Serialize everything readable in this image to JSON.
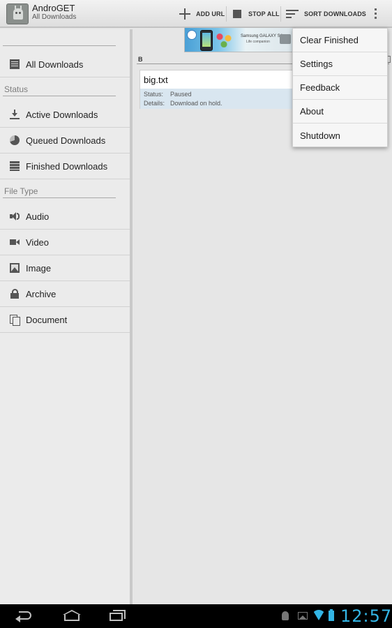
{
  "actionbar": {
    "title": "AndroGET",
    "subtitle": "All Downloads",
    "actions": {
      "add_url": "ADD URL",
      "stop_all": "STOP ALL",
      "sort_downloads": "SORT DOWNLOADS"
    }
  },
  "sidebar": {
    "all_downloads": "All Downloads",
    "status_section": "Status",
    "status_items": [
      "Active Downloads",
      "Queued Downloads",
      "Finished Downloads"
    ],
    "filetype_section": "File Type",
    "filetype_items": [
      "Audio",
      "Video",
      "Image",
      "Archive",
      "Document"
    ]
  },
  "main": {
    "ad": {
      "text": "Samsung GALAXY S4",
      "tagline": "Life companion"
    },
    "group_header": "B",
    "downloads": [
      {
        "name": "big.txt",
        "status_label": "Status:",
        "status_value": "Paused",
        "details_label": "Details:",
        "details_value": "Download on hold."
      }
    ]
  },
  "overflow_menu": {
    "items": [
      "Clear Finished",
      "Settings",
      "Feedback",
      "About",
      "Shutdown"
    ]
  },
  "system_bar": {
    "clock": "12:57"
  },
  "colors": {
    "accent": "#33b5e5",
    "detail_row": "#d9e6f0"
  }
}
